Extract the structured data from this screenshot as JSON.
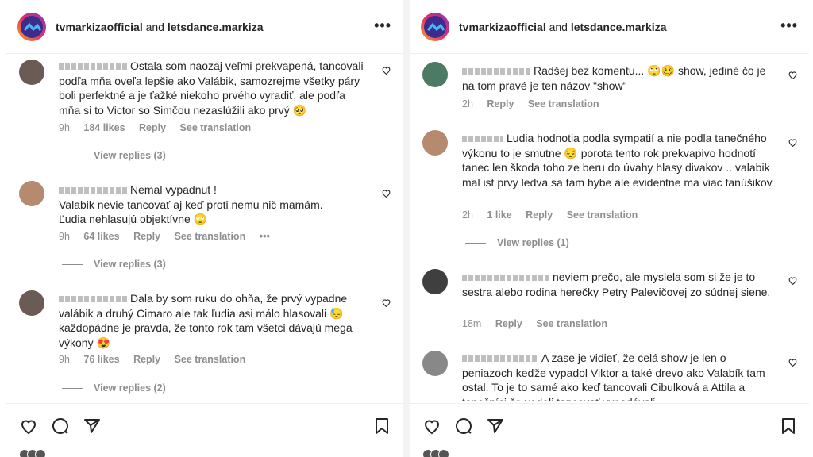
{
  "left": {
    "header": {
      "account": "tvmarkizaofficial",
      "joiner": "and",
      "collab": "letsdance.markiza"
    },
    "comments": [
      {
        "text": "Ostala som naozaj veľmi prekvapená, tancovali podľa mňa oveľa lepšie ako Valábik, samozrejme všetky páry boli perfektné a je ťažké niekoho prvého vyradiť, ale podľa mňa si to Victor so Simčou nezaslúžili ako prvý 🥺",
        "time": "9h",
        "likes": "184 likes",
        "reply": "Reply",
        "translate": "See translation",
        "replies": "View replies (3)"
      },
      {
        "text": "Nemal vypadnut !\nValabik nevie tancovať aj keď proti nemu nič mamám.\nĽudia nehlasujú objektívne 🙄",
        "time": "9h",
        "likes": "64 likes",
        "reply": "Reply",
        "translate": "See translation",
        "more": "•••",
        "replies": "View replies (3)"
      },
      {
        "text": "Dala by som ruku do ohňa, že prvý vypadne valábik a druhý Cimaro ale tak ľudia asi málo hlasovali 😓 každopádne je pravda, že tonto rok tam všetci dávajú mega výkony 😍",
        "time": "9h",
        "likes": "76 likes",
        "reply": "Reply",
        "translate": "See translation",
        "replies": "View replies (2)"
      }
    ]
  },
  "right": {
    "header": {
      "account": "tvmarkizaofficial",
      "joiner": "and",
      "collab": "letsdance.markiza"
    },
    "comments": [
      {
        "text": "Radšej bez komentu... 🙄🥴 show, jediné čo je na tom pravé je ten názov \"show\"",
        "time": "2h",
        "reply": "Reply",
        "translate": "See translation"
      },
      {
        "text": "Ludia hodnotia podla sympatií a nie podla tanečného výkonu to je smutne 😔 porota tento rok prekvapivo hodnotí tanec len škoda toho ze beru do úvahy hlasy divakov .. valabik mal ist prvy ledva sa tam hybe ale evidentne ma viac fanúšikov",
        "time": "2h",
        "likes": "1 like",
        "reply": "Reply",
        "translate": "See translation",
        "replies": "View replies (1)"
      },
      {
        "text": "neviem prečo, ale myslela som si že je to sestra alebo rodina herečky Petry Palevičovej zo súdnej siene.",
        "time": "18m",
        "reply": "Reply",
        "translate": "See translation"
      },
      {
        "text": "A zase je vidieť, že celá show je len o peniazoch keďže vypadol Viktor a také drevo ako Valabík tam ostal. To je to samé ako keď tancovali Cibulková a Attila a tanečníci čo vedeli tancovať vypadávali",
        "time": "",
        "reply": "",
        "translate": ""
      }
    ]
  },
  "icons": [
    "heart-icon",
    "comment-icon",
    "share-icon",
    "bookmark-icon",
    "more-icon"
  ],
  "colors": {
    "text": "#262626",
    "meta": "#8e8e8e",
    "brand": "#3b2c8e"
  }
}
